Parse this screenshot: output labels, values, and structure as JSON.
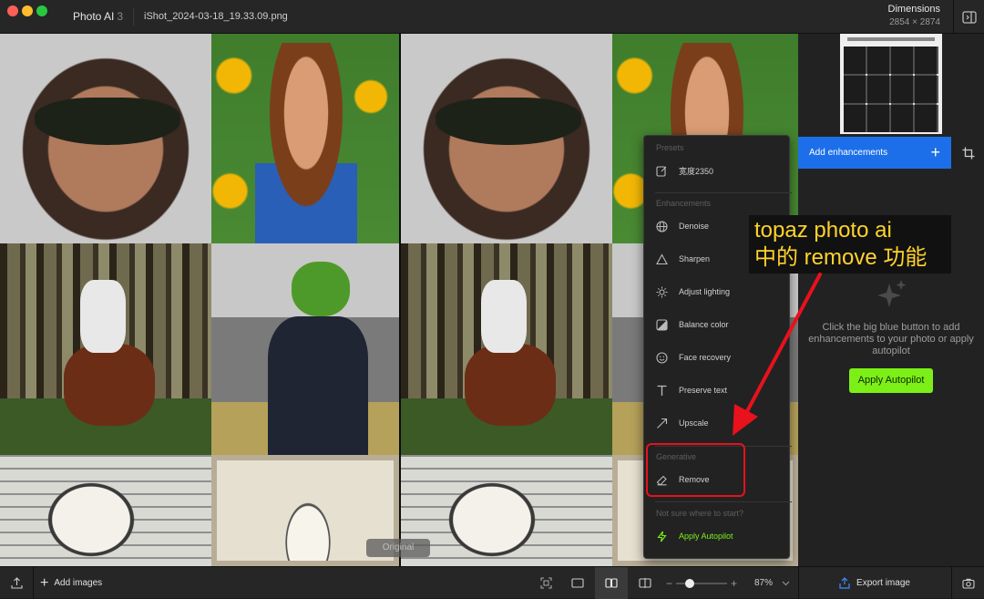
{
  "titlebar": {
    "app_name": "Photo AI",
    "app_version": "3",
    "filename": "iShot_2024-03-18_19.33.09.png",
    "dimensions_label": "Dimensions",
    "dimensions_value": "2854 × 2874",
    "traffic_lights": [
      "#ff5f57",
      "#febc2e",
      "#28c840"
    ]
  },
  "canvas": {
    "original_label": "Original"
  },
  "menu": {
    "presets_header": "Presets",
    "preset_item": "宽度2350",
    "enhancements_header": "Enhancements",
    "enhancements": [
      {
        "label": "Denoise",
        "icon": "globe-icon"
      },
      {
        "label": "Sharpen",
        "icon": "triangle-icon"
      },
      {
        "label": "Adjust lighting",
        "icon": "sun-icon"
      },
      {
        "label": "Balance color",
        "icon": "color-balance-icon"
      },
      {
        "label": "Face recovery",
        "icon": "face-icon"
      },
      {
        "label": "Preserve text",
        "icon": "text-icon"
      },
      {
        "label": "Upscale",
        "icon": "upscale-arrow-icon"
      }
    ],
    "generative_header": "Generative",
    "remove_label": "Remove",
    "not_sure_header": "Not sure where to start?",
    "apply_autopilot_label": "Apply Autopilot"
  },
  "right_panel": {
    "add_enhancements_label": "Add enhancements",
    "hint_text": "Click the big blue button to add enhancements to your photo or apply autopilot",
    "autopilot_button": "Apply Autopilot"
  },
  "annotation": {
    "line1": "topaz photo ai",
    "line2": "中的 remove 功能"
  },
  "bottom": {
    "add_images_label": "Add images",
    "zoom": "87%",
    "export_label": "Export image"
  },
  "colors": {
    "accent_blue": "#1c6fe8",
    "autopilot_green": "#7cf016",
    "annotation_red": "#e8111c",
    "annotation_yellow": "#ffd32a"
  }
}
